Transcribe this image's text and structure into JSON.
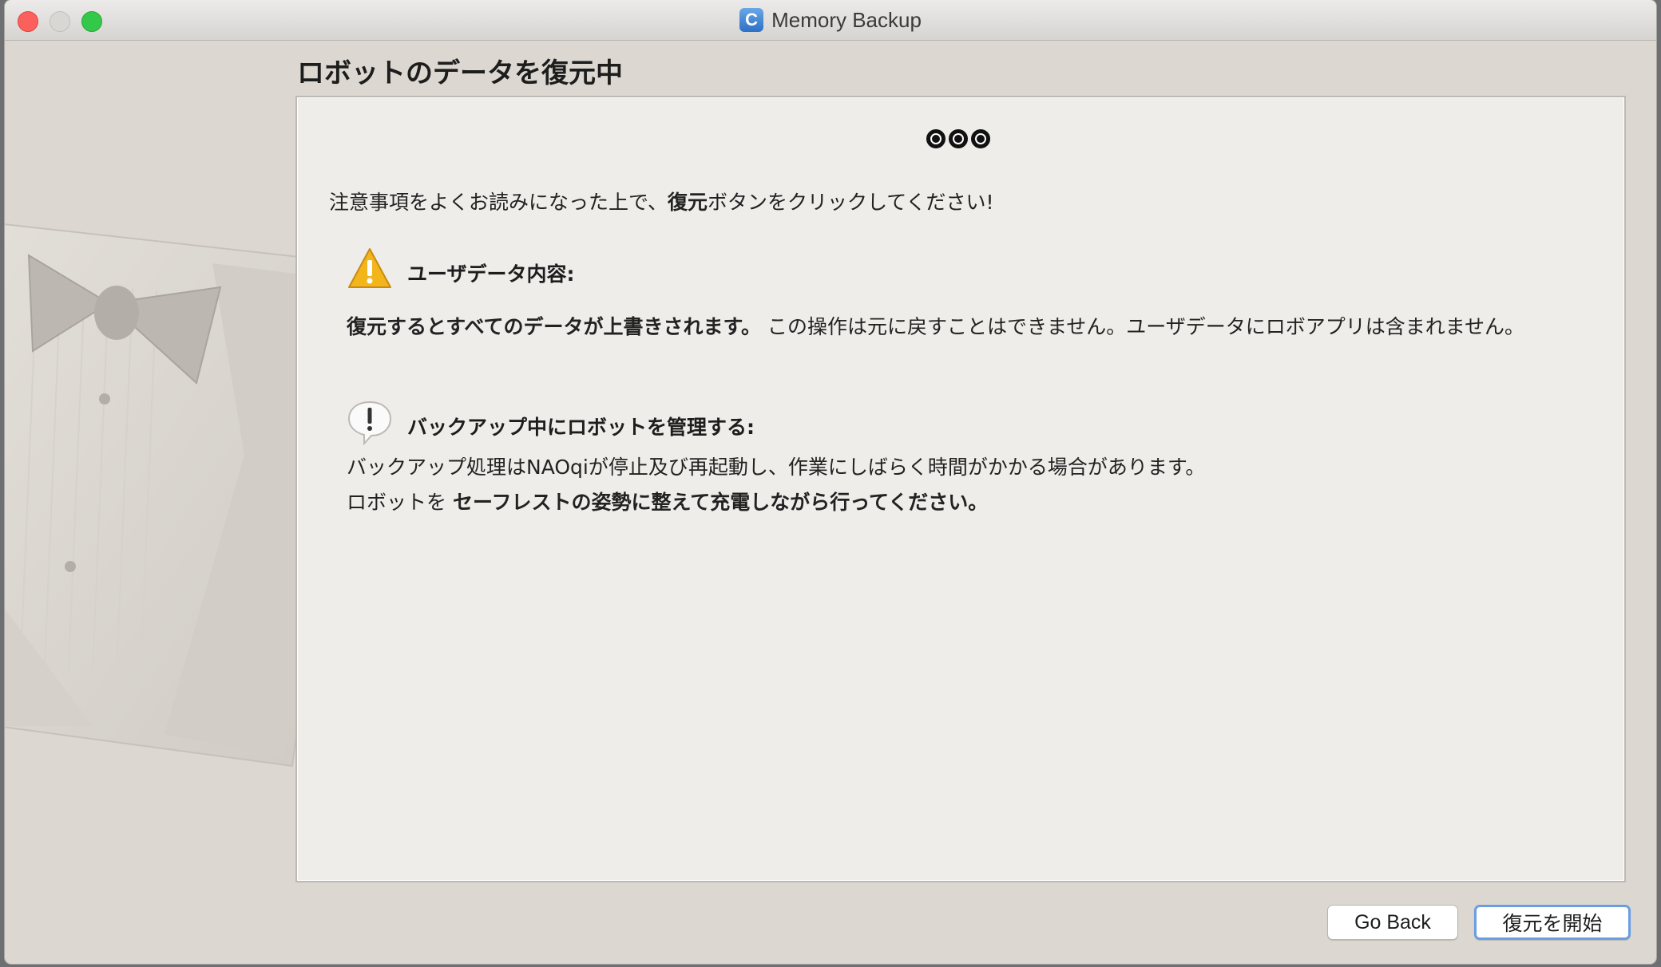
{
  "window": {
    "title": "Memory Backup",
    "app_icon_letter": "C"
  },
  "page": {
    "heading": "ロボットのデータを復元中",
    "progress_step_icons": [
      "step-1-icon",
      "step-2-icon",
      "step-3-icon"
    ]
  },
  "intro": {
    "before": "注意事項をよくお読みになった上で、",
    "bold": "復元",
    "after": "ボタンをクリックしてください!"
  },
  "section_user_data": {
    "icon": "warning-triangle-icon",
    "title": "ユーザデータ内容:",
    "body_bold": "復元するとすべてのデータが上書きされます。",
    "body_rest": " この操作は元に戻すことはできません。ユーザデータにロボアプリは含まれません。"
  },
  "section_manage": {
    "icon": "exclamation-bubble-icon",
    "title": "バックアップ中にロボットを管理する:",
    "line1": "バックアップ処理はNAOqiが停止及び再起動し、作業にしばらく時間がかかる場合があります。",
    "line2_prefix": "ロボットを ",
    "line2_bold": "セーフレストの姿勢に整えて充電しながら行ってください。"
  },
  "buttons": {
    "go_back": "Go Back",
    "start_restore": "復元を開始"
  },
  "colors": {
    "window_bg": "#dcd8d1",
    "panel_bg": "#eeedea",
    "default_button_ring": "#6a9ee3",
    "warning_yellow": "#f2b51c"
  }
}
